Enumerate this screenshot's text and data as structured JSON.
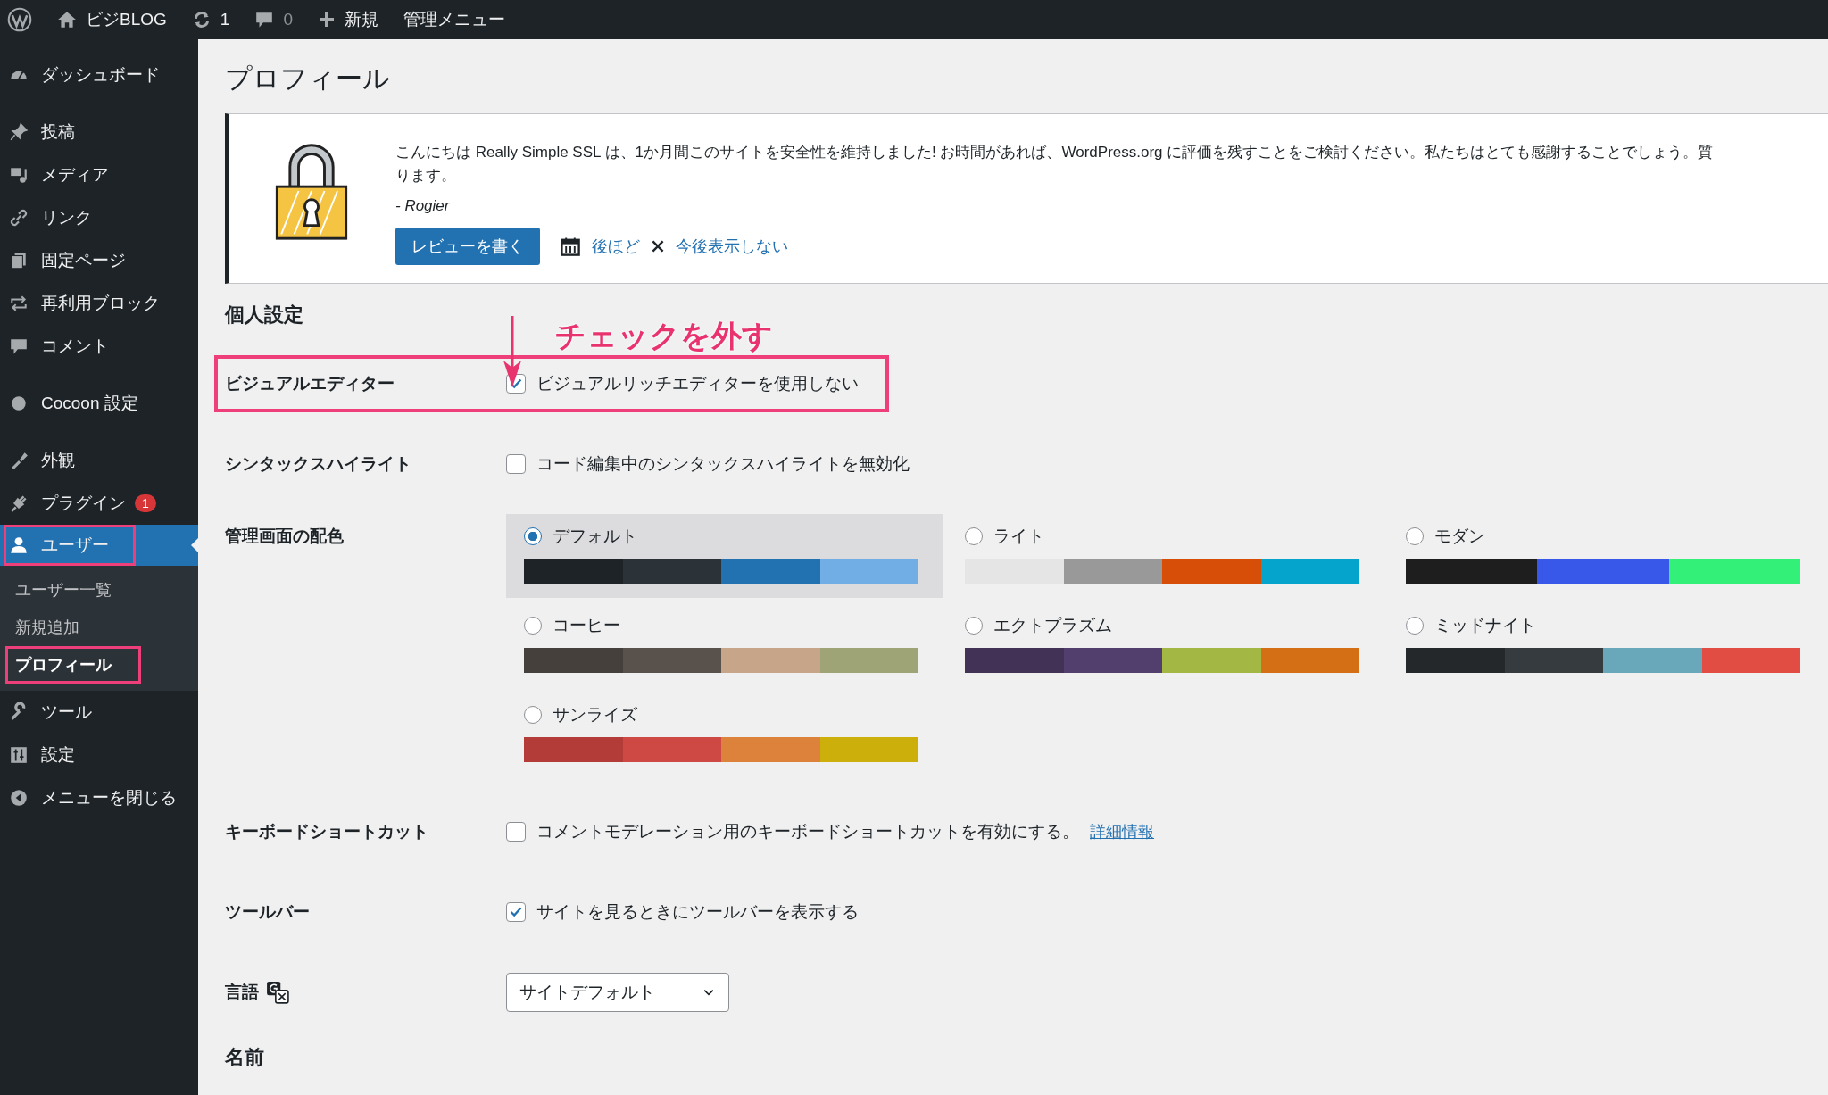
{
  "topbar": {
    "site": "ビジBLOG",
    "updates": "1",
    "comments": "0",
    "new": "新規",
    "admin_menu": "管理メニュー"
  },
  "sidebar": {
    "groups": [
      [
        {
          "label": "ダッシュボード",
          "current": false,
          "highlighted": false
        }
      ],
      [
        {
          "label": "投稿",
          "current": false,
          "highlighted": false
        },
        {
          "label": "メディア",
          "current": false,
          "highlighted": false
        },
        {
          "label": "リンク",
          "current": false,
          "highlighted": false
        },
        {
          "label": "固定ページ",
          "current": false,
          "highlighted": false
        },
        {
          "label": "再利用ブロック",
          "current": false,
          "highlighted": false
        },
        {
          "label": "コメント",
          "current": false,
          "highlighted": false
        }
      ],
      [
        {
          "label": "Cocoon 設定",
          "current": false,
          "highlighted": false
        }
      ],
      [
        {
          "label": "外観",
          "current": false,
          "highlighted": false
        },
        {
          "label": "プラグイン",
          "badge": "1",
          "current": false,
          "highlighted": false
        },
        {
          "label": "ユーザー",
          "current": true,
          "highlighted": true,
          "submenu": [
            {
              "label": "ユーザー一覧",
              "selected": false,
              "highlighted": false
            },
            {
              "label": "新規追加",
              "selected": false,
              "highlighted": false
            },
            {
              "label": "プロフィール",
              "selected": true,
              "highlighted": true
            }
          ]
        },
        {
          "label": "ツール",
          "current": false,
          "highlighted": false
        },
        {
          "label": "設定",
          "current": false,
          "highlighted": false
        },
        {
          "label": "メニューを閉じる",
          "current": false,
          "highlighted": false
        }
      ]
    ]
  },
  "page_title": "プロフィール",
  "notice": {
    "lines": [
      "こんにちは Really Simple SSL は、1か月間このサイトを安全性を維持しました! お時間があれば、WordPress.org に評価を残すことをご検討ください。私たちはとても感謝することでしょう。質",
      "ります。"
    ],
    "author": "- Rogier",
    "button": "レビューを書く",
    "later": "後ほど",
    "dismiss": "今後表示しない"
  },
  "section_title": "個人設定",
  "annotation": {
    "text": "チェックを外す"
  },
  "rows": [
    {
      "kind": "checkbox",
      "label": "ビジュアルエディター",
      "text": "ビジュアルリッチエディターを使用しない",
      "checked": true,
      "highlighted": true
    },
    {
      "kind": "checkbox",
      "label": "シンタックスハイライト",
      "text": "コード編集中のシンタックスハイライトを無効化",
      "checked": false,
      "highlighted": false
    },
    {
      "kind": "schemes",
      "label": "管理画面の配色",
      "schemes": [
        {
          "name": "デフォルト",
          "selected": true,
          "swatches": [
            {
              "color": "#1d2327"
            },
            {
              "color": "#2c3338"
            },
            {
              "color": "#2271b1"
            },
            {
              "color": "#72aee6"
            }
          ]
        },
        {
          "name": "ライト",
          "selected": false,
          "swatches": [
            {
              "color": "#e5e5e5"
            },
            {
              "color": "#999999"
            },
            {
              "color": "#d64e07"
            },
            {
              "color": "#04a4cc"
            }
          ]
        },
        {
          "name": "モダン",
          "selected": false,
          "swatches": [
            {
              "color": "#1e1e1e"
            },
            {
              "color": "#3858e9"
            },
            {
              "color": "#33f078"
            }
          ]
        },
        {
          "name": "コーヒー",
          "selected": false,
          "swatches": [
            {
              "color": "#46403c"
            },
            {
              "color": "#59524c"
            },
            {
              "color": "#c7a589"
            },
            {
              "color": "#9ea476"
            }
          ]
        },
        {
          "name": "エクトプラズム",
          "selected": false,
          "swatches": [
            {
              "color": "#413256"
            },
            {
              "color": "#523f6d"
            },
            {
              "color": "#a3b745"
            },
            {
              "color": "#d46f15"
            }
          ]
        },
        {
          "name": "ミッドナイト",
          "selected": false,
          "swatches": [
            {
              "color": "#25282b"
            },
            {
              "color": "#363b3f"
            },
            {
              "color": "#69a8bb"
            },
            {
              "color": "#e14d43"
            }
          ]
        },
        {
          "name": "サンライズ",
          "selected": false,
          "swatches": [
            {
              "color": "#b43c38"
            },
            {
              "color": "#cf4944"
            },
            {
              "color": "#dd823b"
            },
            {
              "color": "#ccaf0b"
            }
          ]
        }
      ]
    },
    {
      "kind": "checkbox",
      "label": "キーボードショートカット",
      "text": "コメントモデレーション用のキーボードショートカットを有効にする。",
      "link": "詳細情報",
      "checked": false,
      "highlighted": false
    },
    {
      "kind": "checkbox",
      "label": "ツールバー",
      "text": "サイトを見るときにツールバーを表示する",
      "checked": true,
      "highlighted": false
    },
    {
      "kind": "select",
      "label": "言語",
      "value": "サイトデフォルト"
    }
  ],
  "next_section": "名前"
}
